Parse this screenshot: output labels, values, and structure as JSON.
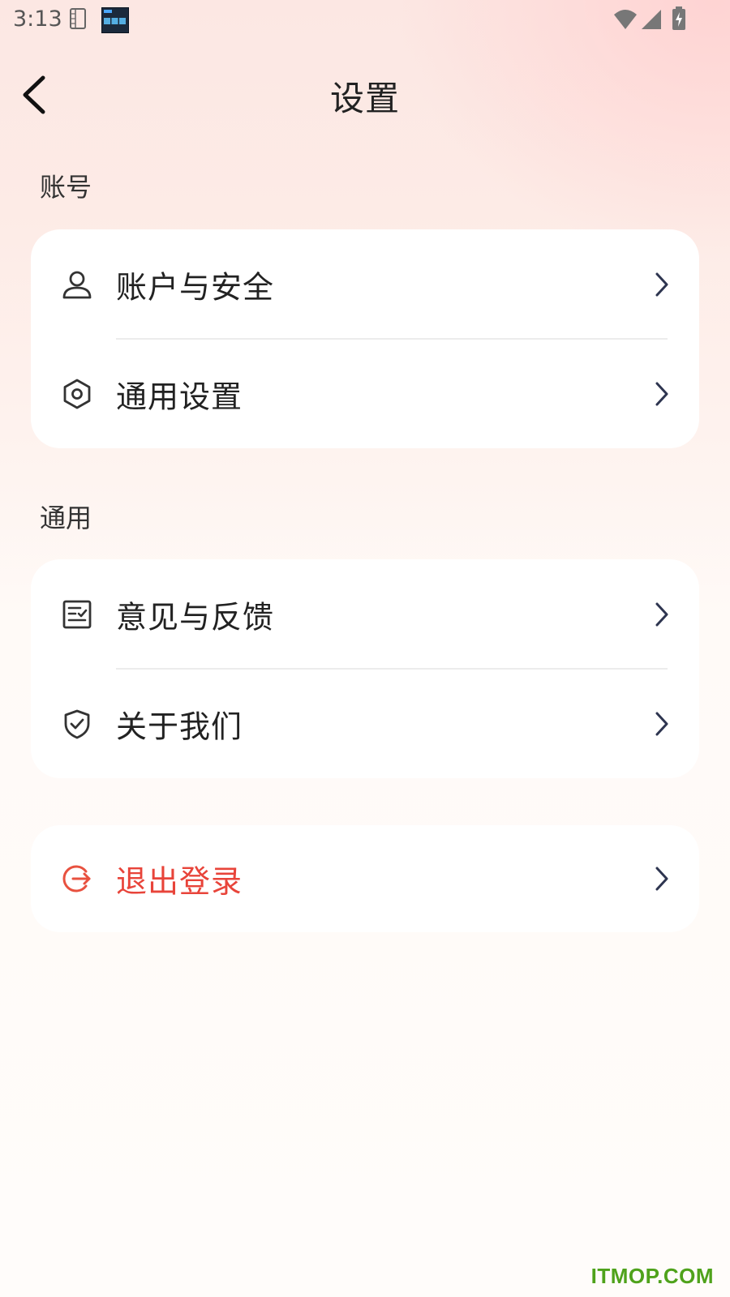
{
  "status_bar": {
    "time": "3:13",
    "icons": [
      "sim-card-icon",
      "clock-app-icon",
      "wifi-icon",
      "cellular-signal-icon",
      "battery-charging-icon"
    ]
  },
  "header": {
    "title": "设置",
    "back_icon": "chevron-left-icon"
  },
  "sections": {
    "account": {
      "heading": "账号",
      "items": [
        {
          "label": "账户与安全",
          "icon": "person-icon"
        },
        {
          "label": "通用设置",
          "icon": "hexagon-gear-icon"
        }
      ]
    },
    "general": {
      "heading": "通用",
      "items": [
        {
          "label": "意见与反馈",
          "icon": "feedback-list-icon"
        },
        {
          "label": "关于我们",
          "icon": "shield-check-icon"
        }
      ]
    },
    "logout": {
      "label": "退出登录",
      "icon": "logout-icon"
    }
  },
  "colors": {
    "danger": "#e8443a",
    "chevron": "#2e3550",
    "card": "#ffffff"
  },
  "watermark": "ITMOP.COM"
}
